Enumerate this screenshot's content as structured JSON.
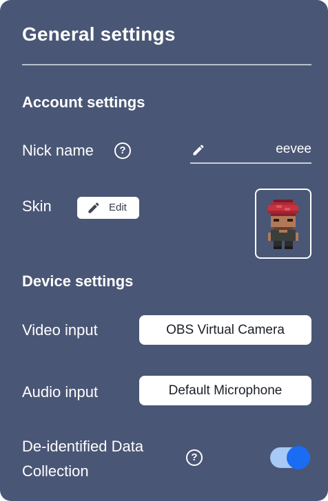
{
  "panel": {
    "title": "General settings",
    "background": "#4a5675"
  },
  "account": {
    "heading": "Account settings",
    "nickname": {
      "label": "Nick name",
      "help_glyph": "?",
      "icon": "pencil-icon",
      "value": "eevee"
    },
    "skin": {
      "label": "Skin",
      "edit_label": "Edit",
      "edit_icon": "pencil-icon",
      "preview": "avatar-sprite"
    }
  },
  "device": {
    "heading": "Device settings",
    "video": {
      "label": "Video input",
      "selected": "OBS Virtual Camera"
    },
    "audio": {
      "label": "Audio input",
      "selected": "Default Microphone"
    },
    "data_collection": {
      "label_line1": "De-identified Data",
      "label_line2": "Collection",
      "help_glyph": "?",
      "enabled": true,
      "accent": "#1a6cf2"
    }
  }
}
